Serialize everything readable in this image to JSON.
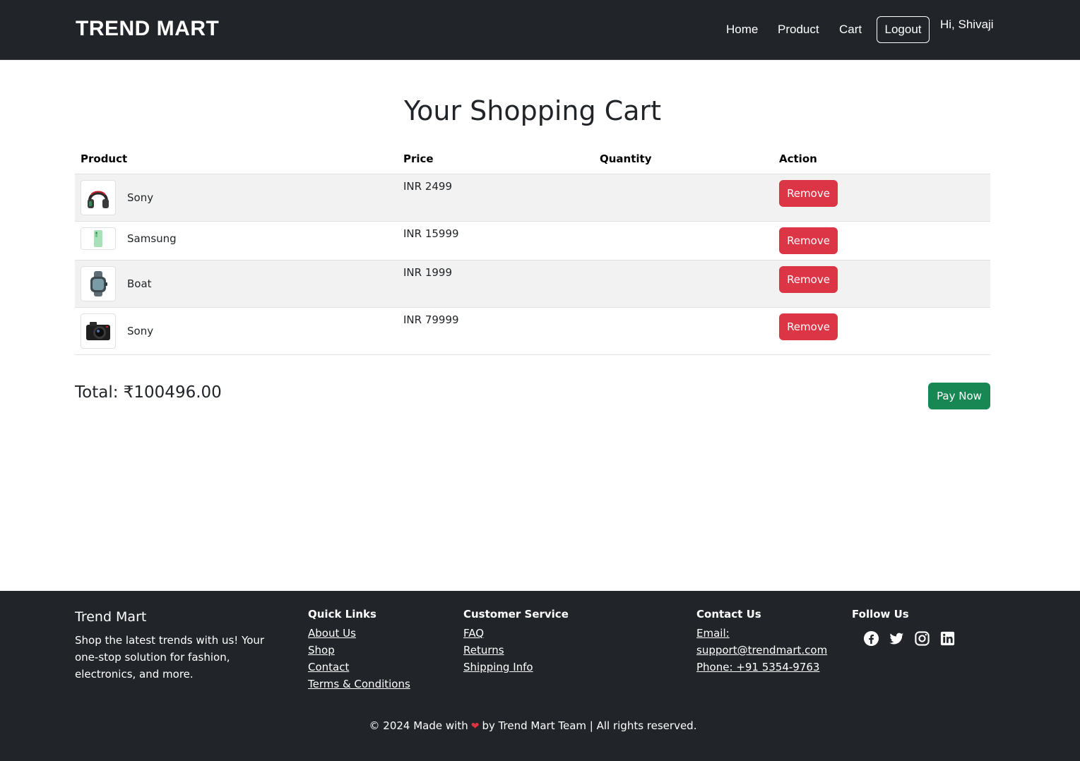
{
  "navbar": {
    "brand": "TREND MART",
    "links": [
      "Home",
      "Product",
      "Cart"
    ],
    "logout_label": "Logout",
    "greeting": "Hi, Shivaji"
  },
  "cart": {
    "title": "Your Shopping Cart",
    "columns": [
      "Product",
      "Price",
      "Quantity",
      "Action"
    ],
    "items": [
      {
        "name": "Sony",
        "price": "INR 2499",
        "quantity": "",
        "action": "Remove",
        "icon": "headphones-icon"
      },
      {
        "name": "Samsung",
        "price": "INR 15999",
        "quantity": "",
        "action": "Remove",
        "icon": "phone-icon"
      },
      {
        "name": "Boat",
        "price": "INR 1999",
        "quantity": "",
        "action": "Remove",
        "icon": "smartwatch-icon"
      },
      {
        "name": "Sony",
        "price": "INR 79999",
        "quantity": "",
        "action": "Remove",
        "icon": "camera-icon"
      }
    ],
    "total_label": "Total: ₹100496.00",
    "pay_label": "Pay Now"
  },
  "footer": {
    "brand": "Trend Mart",
    "about": "Shop the latest trends with us! Your one-stop solution for fashion, electronics, and more.",
    "quick_links": {
      "heading": "Quick Links",
      "items": [
        "About Us",
        "Shop",
        "Contact",
        "Terms & Conditions"
      ]
    },
    "customer_service": {
      "heading": "Customer Service",
      "items": [
        "FAQ",
        "Returns",
        "Shipping Info"
      ]
    },
    "contact": {
      "heading": "Contact Us",
      "email_label": "Email:",
      "email": "support@trendmart.com",
      "phone": "Phone: +91 5354-9763"
    },
    "follow": {
      "heading": "Follow Us",
      "icons": [
        "facebook-icon",
        "twitter-icon",
        "instagram-icon",
        "linkedin-icon"
      ]
    },
    "copyright_pre": "© 2024 Made with",
    "copyright_post": "by Trend Mart Team | All rights reserved."
  },
  "colors": {
    "navbar_bg": "#212529",
    "remove_button": "#dc3545",
    "pay_button": "#198754",
    "heart": "#e0323f"
  }
}
